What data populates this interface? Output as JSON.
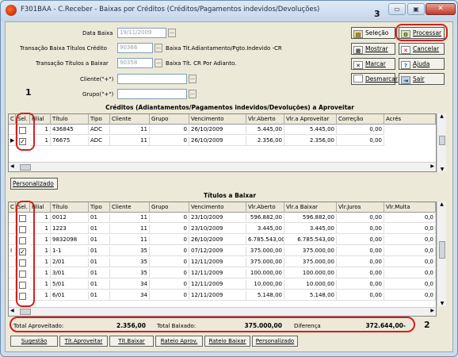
{
  "window": {
    "title": "F301BAA - C.Receber - Baixas por Créditos (Créditos/Pagamentos indevidos/Devoluções)",
    "minimize": "▭",
    "maximize": "▣",
    "close": "✕"
  },
  "form": {
    "data_baixa_label": "Data Baixa",
    "data_baixa_value": "19/11/2009",
    "trans_credito_label": "Transação Baixa Títulos Crédito",
    "trans_credito_value": "90366",
    "trans_credito_desc": "Baixa Tit.Adiantamento/Pgto.Indevido -CR",
    "trans_abaixar_label": "Transação Títulos a Baixar",
    "trans_abaixar_value": "90358",
    "trans_abaixar_desc": "Baixa Tít. CR Por Adianto.",
    "cliente_label": "Cliente(\"+\")",
    "grupo_label": "Grupo(\"+\")",
    "ellipsis": "..."
  },
  "buttons": {
    "selecao": "Seleção",
    "processar": "Processar",
    "mostrar": "Mostrar",
    "cancelar": "Cancelar",
    "marcar": "Marcar",
    "ajuda": "Ajuda",
    "desmarcar": "Desmarcar",
    "sair": "Sair",
    "personalizado": "Personalizado"
  },
  "icons": {
    "selecao": "folder-icon",
    "processar": "gear-icon",
    "mostrar": "grid-icon",
    "cancelar": "x-icon",
    "marcar": "check-icon",
    "ajuda": "help-icon",
    "desmarcar": "box-icon",
    "sair": "exit-icon"
  },
  "creditos": {
    "title": "Créditos (Adiantamentos/Pagamentos indevidos/Devoluções) a Aproveitar",
    "columns": [
      "C",
      "Sel.",
      "Filial",
      "Título",
      "Tipo",
      "Cliente",
      "Grupo",
      "Vencimento",
      "Vlr.Aberto",
      "Vlr.a Aproveitar",
      "Correção",
      "Acrés"
    ],
    "rows": [
      {
        "marker": "",
        "sel": false,
        "filial": "1",
        "titulo": "436845",
        "tipo": "ADC",
        "cliente": "11",
        "grupo": "0",
        "venc": "26/10/2009",
        "aberto": "5.445,00",
        "aproveitar": "5.445,00",
        "correcao": "0,00"
      },
      {
        "marker": "▶",
        "sel": true,
        "filial": "1",
        "titulo": "76675",
        "tipo": "ADC",
        "cliente": "11",
        "grupo": "0",
        "venc": "26/10/2009",
        "aberto": "2.356,00",
        "aproveitar": "2.356,00",
        "correcao": "0,00"
      }
    ]
  },
  "abaixar": {
    "title": "Títulos a Baixar",
    "columns": [
      "C",
      "Sel.",
      "Filial",
      "Título",
      "Tipo",
      "Cliente",
      "Grupo",
      "Vencimento",
      "Vlr.Aberto",
      "Vlr.a Baixar",
      "Vlr.Juros",
      "Vlr.Multa"
    ],
    "rows": [
      {
        "marker": "",
        "sel": false,
        "filial": "1",
        "titulo": "0012",
        "tipo": "01",
        "cliente": "11",
        "grupo": "0",
        "venc": "23/10/2009",
        "aberto": "596.882,00",
        "baixar": "596.882,00",
        "juros": "0,00",
        "multa": "0,0"
      },
      {
        "marker": "",
        "sel": false,
        "filial": "1",
        "titulo": "1223",
        "tipo": "01",
        "cliente": "11",
        "grupo": "0",
        "venc": "23/10/2009",
        "aberto": "3.445,00",
        "baixar": "3.445,00",
        "juros": "0,00",
        "multa": "0,0"
      },
      {
        "marker": "",
        "sel": false,
        "filial": "1",
        "titulo": "9832098",
        "tipo": "01",
        "cliente": "11",
        "grupo": "0",
        "venc": "26/10/2009",
        "aberto": "6.785.543,00",
        "baixar": "6.785.543,00",
        "juros": "0,00",
        "multa": "0,0"
      },
      {
        "marker": "I",
        "sel": true,
        "filial": "1",
        "titulo": "1-1",
        "tipo": "01",
        "cliente": "35",
        "grupo": "0",
        "venc": "07/12/2009",
        "aberto": "375.000,00",
        "baixar": "375.000,00",
        "juros": "0,00",
        "multa": "0,0"
      },
      {
        "marker": "",
        "sel": false,
        "filial": "1",
        "titulo": "2/01",
        "tipo": "01",
        "cliente": "35",
        "grupo": "0",
        "venc": "12/11/2009",
        "aberto": "375.000,00",
        "baixar": "375.000,00",
        "juros": "0,00",
        "multa": "0,0"
      },
      {
        "marker": "",
        "sel": false,
        "filial": "1",
        "titulo": "3/01",
        "tipo": "01",
        "cliente": "35",
        "grupo": "0",
        "venc": "12/11/2009",
        "aberto": "100.000,00",
        "baixar": "100.000,00",
        "juros": "0,00",
        "multa": "0,0"
      },
      {
        "marker": "",
        "sel": false,
        "filial": "1",
        "titulo": "5/01",
        "tipo": "01",
        "cliente": "34",
        "grupo": "0",
        "venc": "12/11/2009",
        "aberto": "10.000,00",
        "baixar": "10.000,00",
        "juros": "0,00",
        "multa": "0,0"
      },
      {
        "marker": "",
        "sel": false,
        "filial": "1",
        "titulo": "6/01",
        "tipo": "01",
        "cliente": "34",
        "grupo": "0",
        "venc": "12/11/2009",
        "aberto": "5.148,00",
        "baixar": "5.148,00",
        "juros": "0,00",
        "multa": "0,0"
      }
    ]
  },
  "totals": {
    "aproveitado_label": "Total Aproveitado:",
    "aproveitado_value": "2.356,00",
    "baixado_label": "Total Baixado:",
    "baixado_value": "375.000,00",
    "diferenca_label": "Diferença",
    "diferenca_value": "372.644,00-"
  },
  "bottom_buttons": [
    "Sugestão",
    "Tít.Aproveitar",
    "Tít.Baixar",
    "Rateio Aprov.",
    "Rateio Baixar",
    "Personalizado"
  ],
  "callouts": {
    "one": "1",
    "two": "2",
    "three": "3"
  },
  "scroll": {
    "up": "▲",
    "down": "▼",
    "left": "◀",
    "right": "▶"
  }
}
